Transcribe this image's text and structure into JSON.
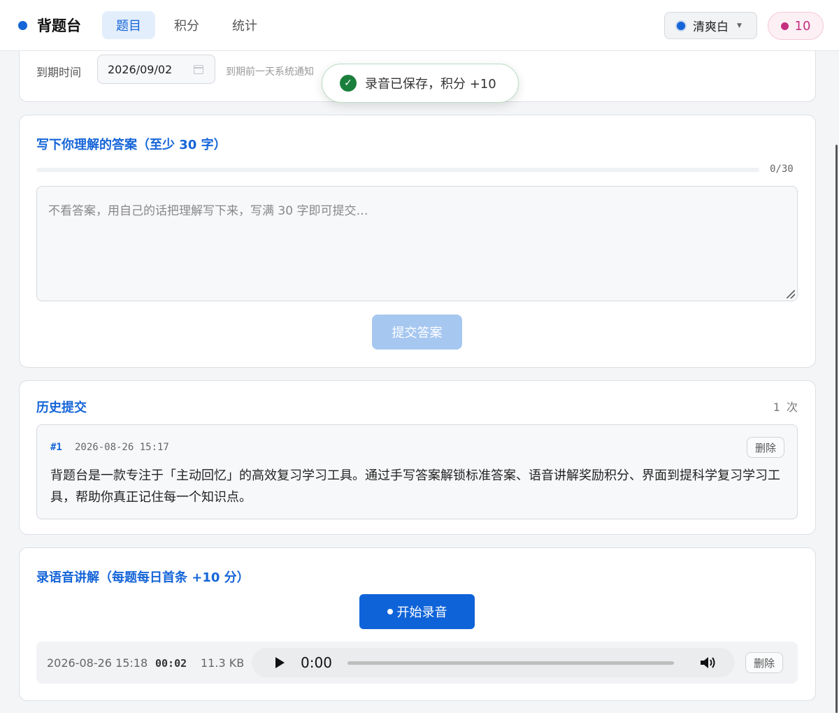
{
  "app": {
    "name": "背题台",
    "brand_color": "#1565d8"
  },
  "nav": {
    "tabs": [
      {
        "label": "题目",
        "active": true
      },
      {
        "label": "积分",
        "active": false
      },
      {
        "label": "统计",
        "active": false
      }
    ]
  },
  "theme": {
    "selected": "清爽白",
    "color": "#1565d8"
  },
  "points": {
    "value": "10",
    "color": "#c42f7f"
  },
  "deadline": {
    "label": "到期时间",
    "date_value": "2026/09/02",
    "hint": "到期前一天系统通知"
  },
  "toast": {
    "message": "录音已保存，积分 +10",
    "icon": "check-circle-icon"
  },
  "answer": {
    "title": "写下你理解的答案（至少 30 字）",
    "char_count": "0/30",
    "progress_fraction": 0,
    "placeholder": "不看答案，用自己的话把理解写下来，写满 30 字即可提交…",
    "submit_label": "提交答案"
  },
  "history": {
    "title": "历史提交",
    "count": "1 次",
    "items": [
      {
        "index": "#1",
        "time": "2026-08-26 15:17",
        "delete_label": "删除",
        "text": "背题台是一款专注于「主动回忆」的高效复习学习工具。通过手写答案解锁标准答案、语音讲解奖励积分、界面到提科学复习学习工具，帮助你真正记住每一个知识点。"
      }
    ]
  },
  "voice": {
    "title": "录语音讲解（每题每日首条 +10 分）",
    "record_label": "开始录音",
    "recordings": [
      {
        "time": "2026-08-26 15:18",
        "duration": "00:02",
        "size": "11.3 KB",
        "player_time": "0:00",
        "delete_label": "删除"
      }
    ]
  }
}
